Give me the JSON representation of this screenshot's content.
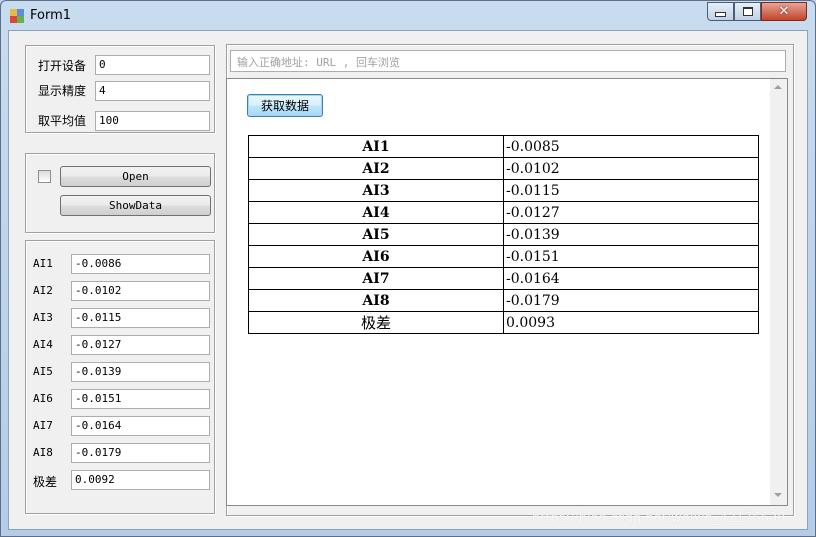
{
  "window": {
    "title": "Form1"
  },
  "config": [
    {
      "label": "打开设备",
      "value": "0"
    },
    {
      "label": "显示精度",
      "value": "4"
    },
    {
      "label": "取平均值",
      "value": "100"
    }
  ],
  "actions": {
    "open_label": "Open",
    "showdata_label": "ShowData",
    "checkbox_checked": false
  },
  "readings": [
    {
      "label": "AI1",
      "value": "-0.0086"
    },
    {
      "label": "AI2",
      "value": "-0.0102"
    },
    {
      "label": "AI3",
      "value": "-0.0115"
    },
    {
      "label": "AI4",
      "value": "-0.0127"
    },
    {
      "label": "AI5",
      "value": "-0.0139"
    },
    {
      "label": "AI6",
      "value": "-0.0151"
    },
    {
      "label": "AI7",
      "value": "-0.0164"
    },
    {
      "label": "AI8",
      "value": "-0.0179"
    },
    {
      "label": "极差",
      "value": "0.0092"
    }
  ],
  "browser": {
    "url_placeholder": "输入正确地址: URL , 回车浏览",
    "fetch_label": "获取数据",
    "table": [
      {
        "key": "AI1",
        "value": "-0.0085"
      },
      {
        "key": "AI2",
        "value": "-0.0102"
      },
      {
        "key": "AI3",
        "value": "-0.0115"
      },
      {
        "key": "AI4",
        "value": "-0.0127"
      },
      {
        "key": "AI5",
        "value": "-0.0139"
      },
      {
        "key": "AI6",
        "value": "-0.0151"
      },
      {
        "key": "AI7",
        "value": "-0.0164"
      },
      {
        "key": "AI8",
        "value": "-0.0179"
      },
      {
        "key": "极差",
        "value": "0.0093"
      }
    ]
  },
  "watermark": "https://blog.csdn.net/weixin_42176638"
}
